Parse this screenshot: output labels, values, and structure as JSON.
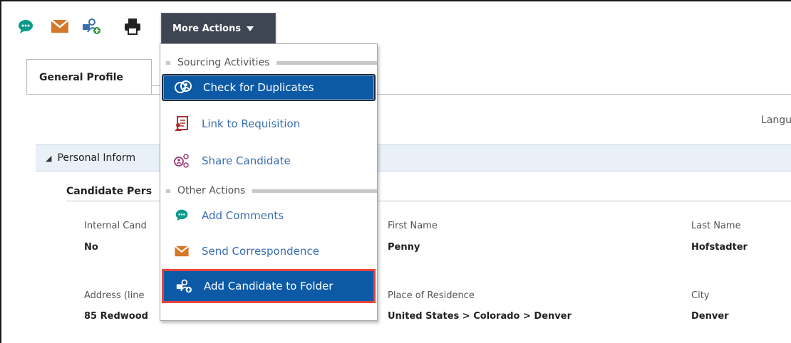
{
  "toolbar": {
    "icons": [
      "comment-icon",
      "mail-icon",
      "add-to-folder-icon",
      "print-icon"
    ],
    "more_actions_label": "More Actions"
  },
  "colors": {
    "accent_blue": "#0c5aa6",
    "toolbar_button": "#3d4652",
    "highlight_red": "#e8433f",
    "comment_green": "#0a9a8a",
    "mail_orange": "#d6782a"
  },
  "tabs": [
    {
      "label": "General Profile",
      "active": true
    }
  ],
  "language_label": "Langu",
  "section": {
    "title": "Personal Inform",
    "subsection_title": "Candidate Pers"
  },
  "fields": {
    "internal_candidate": {
      "label": "Internal Cand",
      "value": "No"
    },
    "first_name": {
      "label": "First Name",
      "value": "Penny"
    },
    "last_name": {
      "label": "Last Name",
      "value": "Hofstadter"
    },
    "address_line": {
      "label": "Address (line",
      "value": "85 Redwood"
    },
    "place_of_residence": {
      "label": "Place of Residence",
      "value": "United States > Colorado > Denver"
    },
    "city": {
      "label": "City",
      "value": "Denver"
    }
  },
  "dropdown": {
    "groups": [
      {
        "label": "Sourcing Activities",
        "items": [
          {
            "label": "Check for Duplicates",
            "icon": "check-duplicates-icon",
            "state": "active"
          },
          {
            "label": "Link to Requisition",
            "icon": "link-requisition-icon",
            "state": "normal"
          },
          {
            "label": "Share Candidate",
            "icon": "share-candidate-icon",
            "state": "normal"
          }
        ]
      },
      {
        "label": "Other Actions",
        "items": [
          {
            "label": "Add Comments",
            "icon": "comment-icon",
            "state": "normal"
          },
          {
            "label": "Send Correspondence",
            "icon": "mail-icon",
            "state": "normal"
          },
          {
            "label": "Add Candidate to Folder",
            "icon": "add-to-folder-icon",
            "state": "highlighted"
          }
        ]
      }
    ]
  }
}
